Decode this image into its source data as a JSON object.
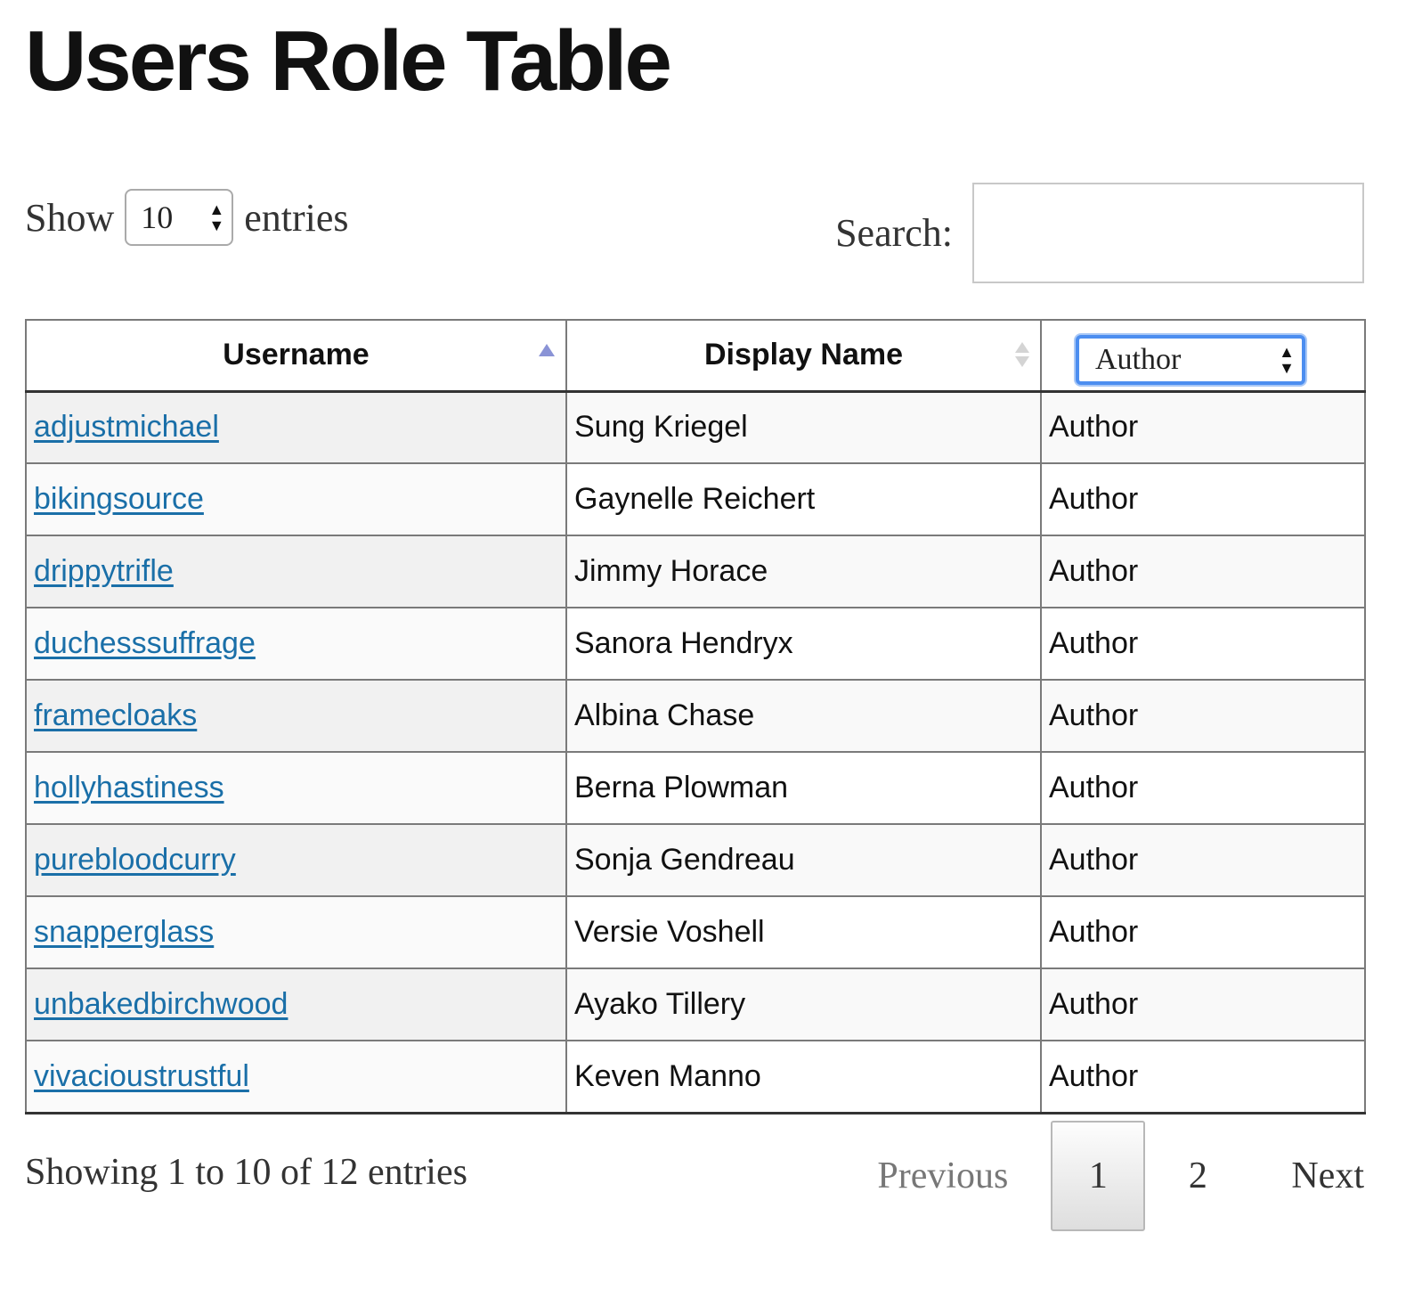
{
  "page": {
    "title": "Users Role Table"
  },
  "length_control": {
    "show_label": "Show",
    "selected": "10",
    "entries_label": "entries"
  },
  "search": {
    "label": "Search:",
    "value": "",
    "placeholder": ""
  },
  "table": {
    "columns": [
      {
        "label": "Username",
        "sort": "ascending"
      },
      {
        "label": "Display Name",
        "sort": "none"
      },
      {
        "label": "Author",
        "type": "role-filter-select"
      }
    ],
    "rows": [
      {
        "username": "adjustmichael",
        "display_name": "Sung Kriegel",
        "role": "Author"
      },
      {
        "username": "bikingsource",
        "display_name": "Gaynelle Reichert",
        "role": "Author"
      },
      {
        "username": "drippytrifle",
        "display_name": "Jimmy Horace",
        "role": "Author"
      },
      {
        "username": "duchesssuffrage",
        "display_name": "Sanora Hendryx",
        "role": "Author"
      },
      {
        "username": "framecloaks",
        "display_name": "Albina Chase",
        "role": "Author"
      },
      {
        "username": "hollyhastiness",
        "display_name": "Berna Plowman",
        "role": "Author"
      },
      {
        "username": "purebloodcurry",
        "display_name": "Sonja Gendreau",
        "role": "Author"
      },
      {
        "username": "snapperglass",
        "display_name": "Versie Voshell",
        "role": "Author"
      },
      {
        "username": "unbakedbirchwood",
        "display_name": "Ayako Tillery",
        "role": "Author"
      },
      {
        "username": "vivacioustrustful",
        "display_name": "Keven Manno",
        "role": "Author"
      }
    ]
  },
  "footer": {
    "info": "Showing 1 to 10 of 12 entries",
    "pagination": {
      "previous": "Previous",
      "pages": [
        "1",
        "2"
      ],
      "current": "1",
      "next": "Next"
    }
  },
  "colors": {
    "link": "#1a6fa8",
    "sort_active": "#8a93d6",
    "focus_ring": "#4c8ef0"
  }
}
